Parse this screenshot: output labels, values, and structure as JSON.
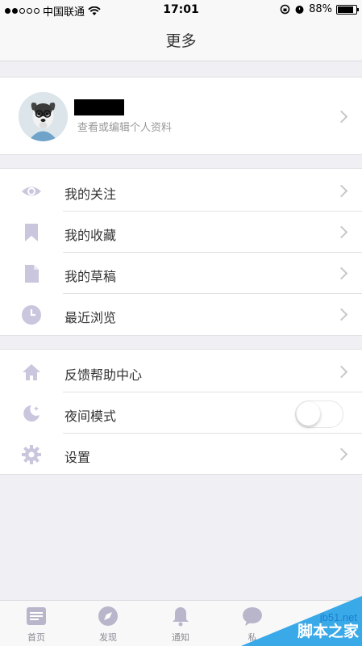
{
  "status_bar": {
    "carrier": "中国联通",
    "time": "17:01",
    "battery": "88%",
    "battery_level": 0.88,
    "signal_bars_filled": 2,
    "signal_bars_total": 5
  },
  "nav": {
    "title": "更多"
  },
  "profile": {
    "subtitle": "查看或编辑个人资料"
  },
  "menu_group_1": [
    {
      "label": "我的关注",
      "icon": "eye-icon"
    },
    {
      "label": "我的收藏",
      "icon": "bookmark-icon"
    },
    {
      "label": "我的草稿",
      "icon": "document-icon"
    },
    {
      "label": "最近浏览",
      "icon": "clock-icon"
    }
  ],
  "menu_group_2": [
    {
      "label": "反馈帮助中心",
      "icon": "home-icon"
    },
    {
      "label": "夜间模式",
      "icon": "moon-icon",
      "toggle_on": false
    },
    {
      "label": "设置",
      "icon": "gear-icon"
    }
  ],
  "tabs": [
    {
      "label": "首页",
      "icon": "home-list-icon"
    },
    {
      "label": "发现",
      "icon": "compass-icon"
    },
    {
      "label": "通知",
      "icon": "bell-icon"
    },
    {
      "label": "私",
      "icon": "message-icon"
    }
  ],
  "watermark": {
    "site": "jb51.net",
    "text": "脚本之家"
  },
  "colors": {
    "icon": "#c9c6de",
    "background": "#efeff4",
    "accent": "#3aa9e8"
  }
}
